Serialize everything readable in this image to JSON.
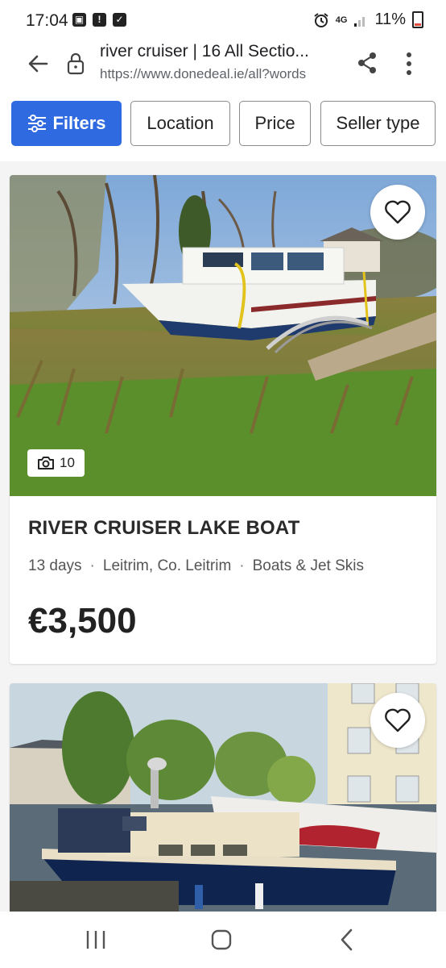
{
  "status_bar": {
    "time": "17:04",
    "network": "4G",
    "battery": "11%"
  },
  "browser": {
    "page_title": "river cruiser | 16 All Sectio...",
    "url": "https://www.donedeal.ie/all?words"
  },
  "filters": {
    "filters_label": "Filters",
    "location_label": "Location",
    "price_label": "Price",
    "seller_type_label": "Seller type",
    "accent_color": "#2f6ae0"
  },
  "listings": [
    {
      "title": "RIVER CRUISER LAKE BOAT",
      "age": "13 days",
      "location": "Leitrim, Co. Leitrim",
      "category": "Boats & Jet Skis",
      "price": "€3,500",
      "photo_count": "10"
    }
  ],
  "icons": {
    "back": "arrow-left-icon",
    "lock": "lock-icon",
    "share": "share-icon",
    "menu": "more-vert-icon",
    "filters": "sliders-icon",
    "favorite": "heart-outline-icon",
    "camera": "camera-icon",
    "nav_recents": "recents-icon",
    "nav_home": "home-icon",
    "nav_back": "chevron-left-icon"
  }
}
